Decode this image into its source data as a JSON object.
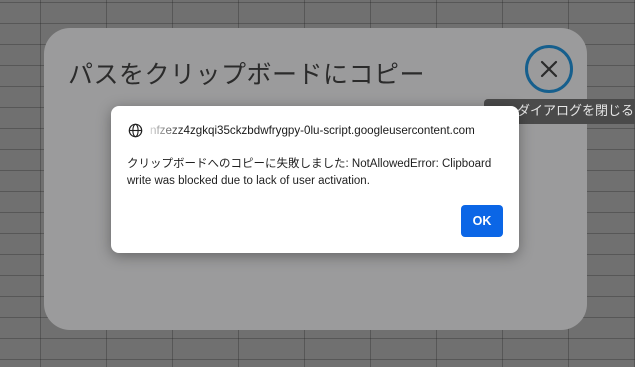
{
  "background": {
    "color": "#707070"
  },
  "copy_dialog": {
    "title": "パスをクリップボードにコピー",
    "close_icon": "close-icon",
    "close_tooltip": "ダイアログを閉じる",
    "close_border_color": "#165f8d"
  },
  "alert": {
    "origin_icon": "globe-icon",
    "origin": "nfzezz4zgkqi35ckzbdwfrygpy-0lu-script.googleusercontent.com",
    "message": "クリップボードへのコピーに失敗しました: NotAllowedError: Clipboard write was blocked due to lack of user activation.",
    "ok_label": "OK",
    "ok_color": "#0b66e6"
  }
}
